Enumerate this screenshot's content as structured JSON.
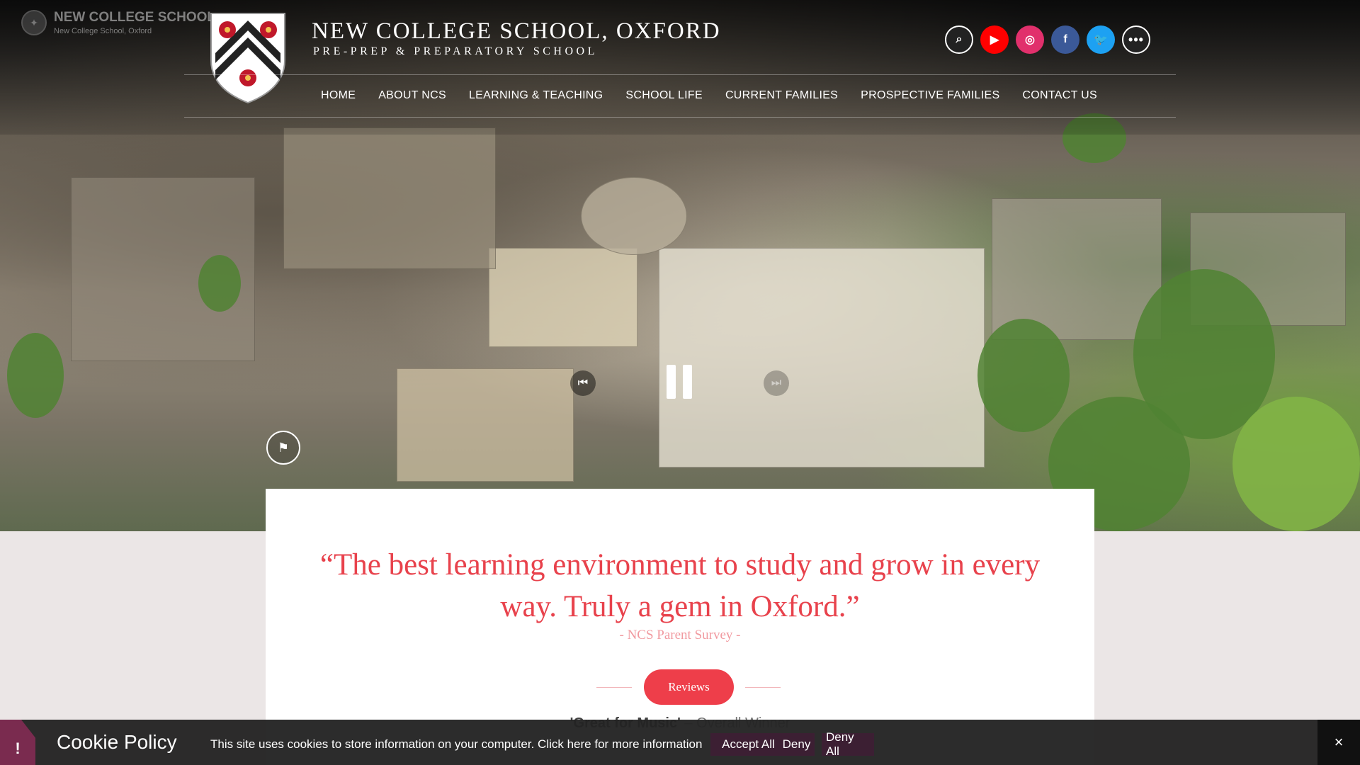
{
  "mini_logo": {
    "title": "NEW COLLEGE SCHOOL",
    "subtitle": "New College School, Oxford"
  },
  "header": {
    "title": "NEW COLLEGE SCHOOL, OXFORD",
    "subtitle": "PRE-PREP & PREPARATORY SCHOOL"
  },
  "social": [
    {
      "name": "search-icon",
      "glyph": "⌕"
    },
    {
      "name": "youtube-icon",
      "glyph": "▶"
    },
    {
      "name": "instagram-icon",
      "glyph": "◎"
    },
    {
      "name": "facebook-icon",
      "glyph": "f"
    },
    {
      "name": "twitter-icon",
      "glyph": "🐦"
    },
    {
      "name": "more-icon",
      "glyph": "•••"
    }
  ],
  "nav": {
    "items": [
      {
        "label": "HOME"
      },
      {
        "label": "ABOUT NCS"
      },
      {
        "label": "LEARNING & TEACHING"
      },
      {
        "label": "SCHOOL LIFE"
      },
      {
        "label": "CURRENT FAMILIES"
      },
      {
        "label": "PROSPECTIVE FAMILIES"
      },
      {
        "label": "CONTACT US"
      }
    ]
  },
  "video": {
    "prev_glyph": "⏮",
    "next_glyph": "⏭",
    "flag_glyph": "⚑"
  },
  "testimonial": {
    "quote": "“The best learning environment to study and grow in every way. Truly a gem in Oxford.”",
    "source": "- NCS Parent Survey -",
    "button": "Reviews",
    "award_bold": "'Great for Music'",
    "award_rest": " – Overall Winner"
  },
  "cookie": {
    "alert_glyph": "!",
    "title": "Cookie Policy",
    "text": "This site uses cookies to store information on your computer. Click here for more information",
    "accept_all": "Accept All",
    "deny": "Deny",
    "deny_all": "Deny All",
    "close_glyph": "×"
  },
  "colors": {
    "accent_red": "#ee3e4a",
    "quote_red": "#e8424c",
    "cookie_button": "#3c1f33",
    "cookie_bar": "#232323"
  }
}
